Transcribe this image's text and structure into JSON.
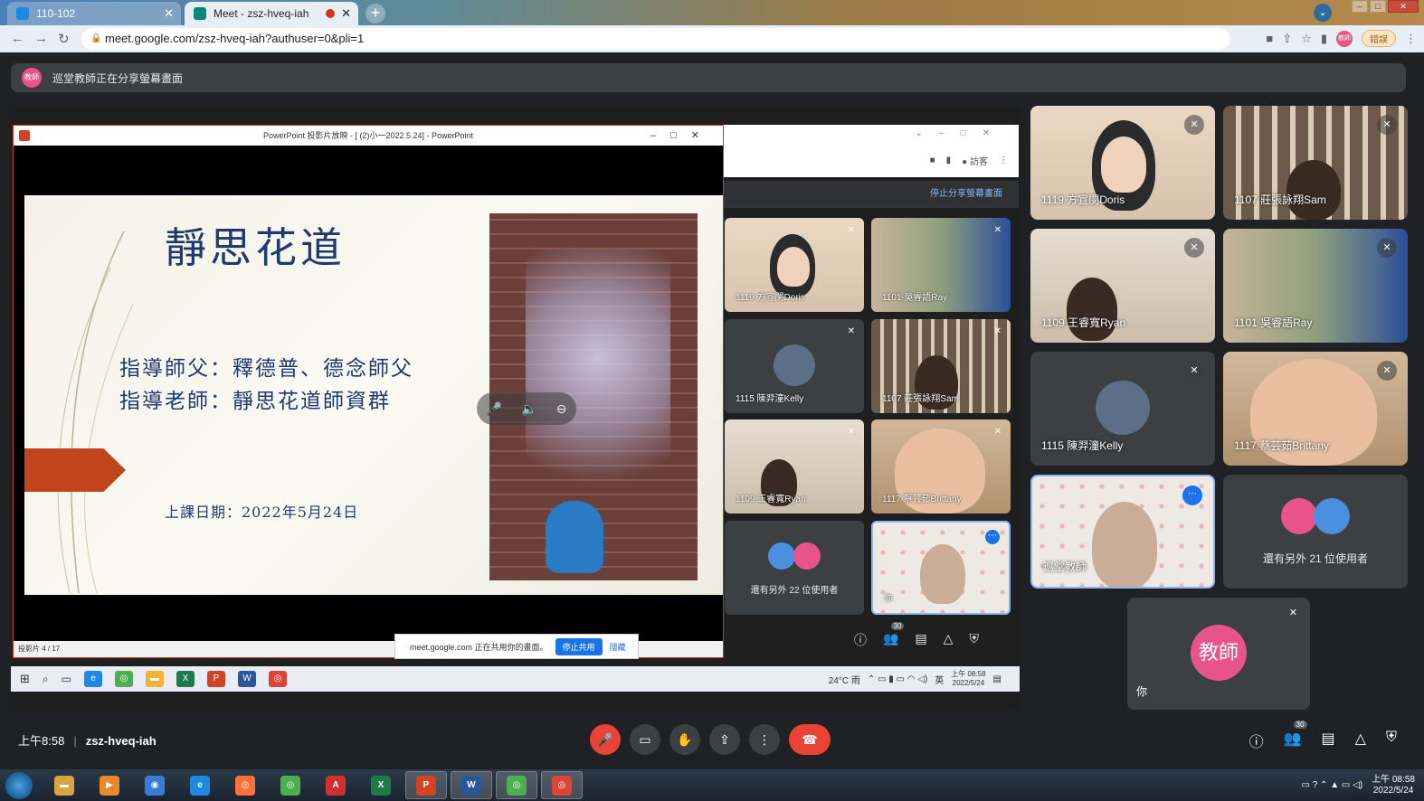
{
  "browser": {
    "tabs": [
      {
        "label": "110-102",
        "active": false
      },
      {
        "label": "Meet - zsz-hveq-iah",
        "active": true,
        "recording": true
      }
    ],
    "url": "meet.google.com/zsz-hveq-iah?authuser=0&pli=1",
    "error_button": "錯誤"
  },
  "presenting": {
    "avatar_text": "教師",
    "message": "巡堂教師正在分享螢幕畫面"
  },
  "ppt_window": {
    "title": "PowerPoint 投影片放映 - [ (2)小一2022.5.24] - PowerPoint",
    "status": "投影片 4 / 17"
  },
  "slide": {
    "title": "靜思花道",
    "line1": "指導師父：釋德普、德念師父",
    "line2": "指導老師：靜思花道師資群",
    "date": "上課日期：2022年5月24日"
  },
  "share_notice": {
    "text": "meet.google.com 正在共用你的畫面。",
    "stop": "停止共用",
    "hide": "隱藏"
  },
  "inner_meet": {
    "guest_label": "訪客",
    "stop_sharing": "停止分享螢幕畫面",
    "tiles": [
      {
        "name": "1119 方宣閔Doris"
      },
      {
        "name": "1101 吳睿語Ray"
      },
      {
        "name": "1115 陳羿潼Kelly"
      },
      {
        "name": "1107 莊張詠翔Sam"
      },
      {
        "name": "1109 王睿寬Ryan"
      },
      {
        "name": "1117 蔡芸茹Brittany"
      },
      {
        "name": "還有另外 22 位使用者"
      },
      {
        "name": "你"
      }
    ],
    "people_count": "30"
  },
  "shared_taskbar": {
    "weather": "24°C 雨",
    "ime": "英",
    "time": "上午 08:58",
    "date": "2022/5/24"
  },
  "participants": [
    {
      "name": "1119 方宣閔Doris"
    },
    {
      "name": "1107 莊張詠翔Sam"
    },
    {
      "name": "1109 王睿寬Ryan"
    },
    {
      "name": "1101 吳睿語Ray"
    },
    {
      "name": "1115 陳羿潼Kelly"
    },
    {
      "name": "1117 蔡芸茹Brittany"
    },
    {
      "name": "巡堂教師"
    },
    {
      "name": "還有另外 21 位使用者"
    }
  ],
  "self_tile": {
    "avatar": "教師",
    "label": "你"
  },
  "meet_bar": {
    "time": "上午8:58",
    "meeting_code": "zsz-hveq-iah",
    "people_count": "30"
  },
  "windows_taskbar": {
    "time": "上午 08:58",
    "date": "2022/5/24"
  }
}
